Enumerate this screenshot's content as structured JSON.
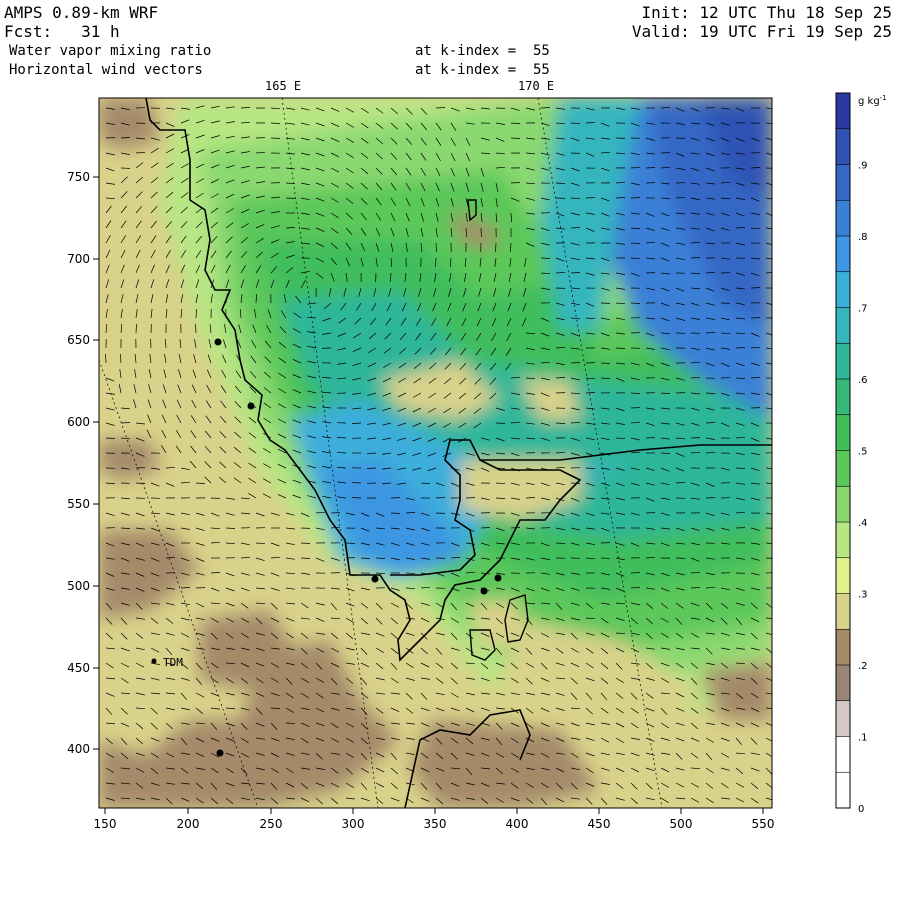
{
  "header": {
    "model": "AMPS 0.89-km WRF",
    "forecast": "Fcst:   31 h",
    "init": "Init: 12 UTC Thu 18 Sep 25",
    "valid": "Valid: 19 UTC Fri 19 Sep 25",
    "field1": "Water vapor mixing ratio",
    "field2": "Horizontal wind vectors",
    "level1": "at k-index =  55",
    "level2": "at k-index =  55"
  },
  "map": {
    "meridian_labels": [
      "165 E",
      "170 E"
    ],
    "x_ticks": [
      "150",
      "200",
      "250",
      "300",
      "350",
      "400",
      "450",
      "500",
      "550"
    ],
    "y_ticks": [
      "750",
      "700",
      "650",
      "600",
      "550",
      "500",
      "450",
      "400"
    ],
    "station_label": "TDM"
  },
  "colorbar": {
    "unit": "g kg",
    "unit_exp": "-1",
    "levels": [
      {
        "label": "",
        "color": "#2b3aa0"
      },
      {
        "label": ".9",
        "color": "#2f52b4"
      },
      {
        "label": "",
        "color": "#3568c6"
      },
      {
        "label": ".8",
        "color": "#3a80d6"
      },
      {
        "label": "",
        "color": "#3d96e2"
      },
      {
        "label": ".7",
        "color": "#3caedb"
      },
      {
        "label": "",
        "color": "#35b6bf"
      },
      {
        "label": ".6",
        "color": "#2fb69a"
      },
      {
        "label": "",
        "color": "#35b877"
      },
      {
        "label": ".5",
        "color": "#3fbe5c"
      },
      {
        "label": "",
        "color": "#5cc85a"
      },
      {
        "label": ".4",
        "color": "#8ad870"
      },
      {
        "label": "",
        "color": "#b7e683"
      },
      {
        "label": ".3",
        "color": "#e0f290"
      },
      {
        "label": "",
        "color": "#d9d28a"
      },
      {
        "label": ".2",
        "color": "#a58a6a"
      },
      {
        "label": "",
        "color": "#9a8478"
      },
      {
        "label": ".1",
        "color": "#d4c8c8"
      },
      {
        "label": "",
        "color": "#ffffff"
      },
      {
        "label": "0",
        "color": "#ffffff"
      }
    ]
  }
}
